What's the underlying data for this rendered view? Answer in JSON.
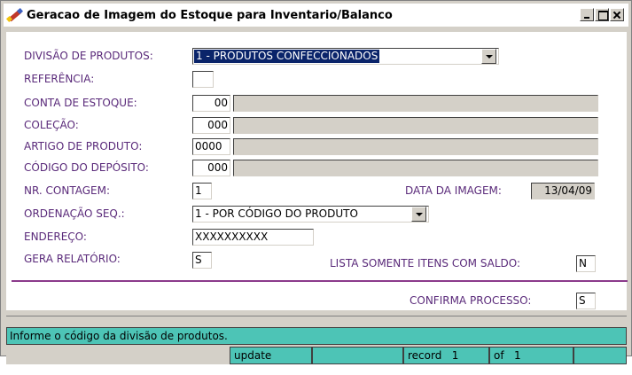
{
  "window": {
    "title": "Geracao de Imagem do Estoque para Inventario/Balanco",
    "app_icon": "pen-icon"
  },
  "form": {
    "divisao": {
      "label": "DIVISÃO DE PRODUTOS:",
      "value": "1 - PRODUTOS CONFECCIONADOS"
    },
    "referencia": {
      "label": "REFERÊNCIA:",
      "value": ""
    },
    "conta": {
      "label": "CONTA DE ESTOQUE:",
      "value": "00",
      "description": ""
    },
    "colecao": {
      "label": "COLEÇÃO:",
      "value": "000",
      "description": ""
    },
    "artigo": {
      "label": "ARTIGO DE PRODUTO:",
      "value": "0000",
      "description": ""
    },
    "deposito": {
      "label": "CÓDIGO DO DEPÓSITO:",
      "value": "000",
      "description": ""
    },
    "contagem": {
      "label": "NR. CONTAGEM:",
      "value": "1"
    },
    "data_imagem": {
      "label": "DATA DA IMAGEM:",
      "value": "13/04/09"
    },
    "ordenacao": {
      "label": "ORDENAÇÃO SEQ.:",
      "value": "1 - POR CÓDIGO DO PRODUTO"
    },
    "endereco": {
      "label": "ENDEREÇO:",
      "value": "XXXXXXXXXX"
    },
    "gera_relatorio": {
      "label": "GERA RELATÓRIO:",
      "value": "S"
    },
    "lista_saldo": {
      "label": "LISTA SOMENTE ITENS COM SALDO:",
      "value": "N"
    },
    "confirma": {
      "label": "CONFIRMA PROCESSO:",
      "value": "S"
    }
  },
  "status": {
    "message": "Informe o código da divisão de produtos.",
    "mode": "update",
    "blank1": "",
    "record_label": "record",
    "record_value": "1",
    "of_label": "of",
    "of_value": "1",
    "blank2": ""
  },
  "colors": {
    "label": "#5a2a7a",
    "status_bg": "#4dc4b6",
    "divider": "#8b3a8b",
    "selection": "#0a246a"
  }
}
